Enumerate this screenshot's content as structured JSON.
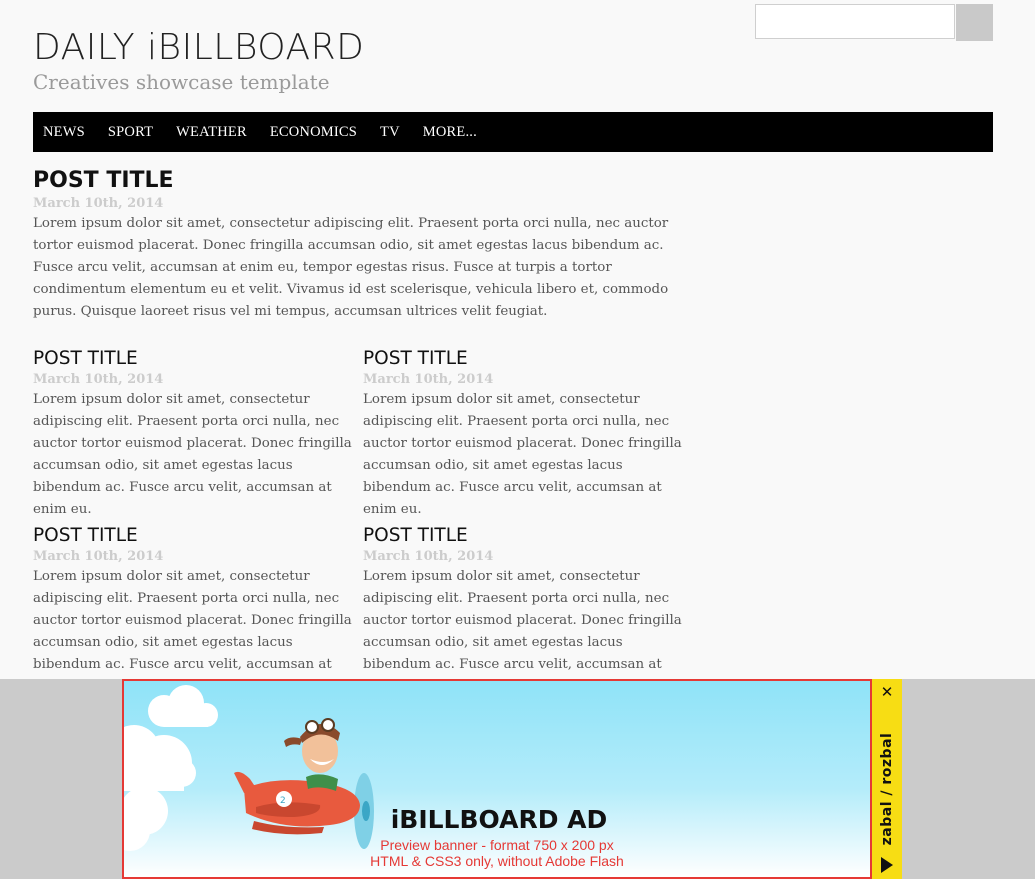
{
  "header": {
    "site_title": "DAILY iBILLBOARD",
    "site_subtitle": "Creatives showcase template"
  },
  "search": {
    "placeholder": "",
    "value": ""
  },
  "nav": {
    "items": [
      "NEWS",
      "SPORT",
      "WEATHER",
      "ECONOMICS",
      "TV",
      "MORE..."
    ]
  },
  "featured_post": {
    "title": "POST TITLE",
    "date": "March 10th, 2014",
    "body": "Lorem ipsum dolor sit amet, consectetur adipiscing elit. Praesent porta orci nulla, nec auctor tortor euismod placerat. Donec fringilla accumsan odio, sit amet egestas lacus bibendum ac. Fusce arcu velit, accumsan at enim eu, tempor egestas risus. Fusce at turpis a tortor condimentum elementum eu et velit. Vivamus id est scelerisque, vehicula libero et, commodo purus. Quisque laoreet risus vel mi tempus, accumsan ultrices velit feugiat."
  },
  "posts": [
    {
      "title": "POST TITLE",
      "date": "March 10th, 2014",
      "body": "Lorem ipsum dolor sit amet, consectetur adipiscing elit. Praesent porta orci nulla, nec auctor tortor euismod placerat. Donec fringilla accumsan odio, sit amet egestas lacus bibendum ac. Fusce arcu velit, accumsan at enim eu."
    },
    {
      "title": "POST TITLE",
      "date": "March 10th, 2014",
      "body": "Lorem ipsum dolor sit amet, consectetur adipiscing elit. Praesent porta orci nulla, nec auctor tortor euismod placerat. Donec fringilla accumsan odio, sit amet egestas lacus bibendum ac. Fusce arcu velit, accumsan at enim eu."
    },
    {
      "title": "POST TITLE",
      "date": "March 10th, 2014",
      "body": "Lorem ipsum dolor sit amet, consectetur adipiscing elit. Praesent porta orci nulla, nec auctor tortor euismod placerat. Donec fringilla accumsan odio, sit amet egestas lacus bibendum ac. Fusce arcu velit, accumsan at enim eu."
    },
    {
      "title": "POST TITLE",
      "date": "March 10th, 2014",
      "body": "Lorem ipsum dolor sit amet, consectetur adipiscing elit. Praesent porta orci nulla, nec auctor tortor euismod placerat. Donec fringilla accumsan odio, sit amet egestas lacus bibendum ac. Fusce arcu velit, accumsan at enim eu."
    }
  ],
  "ad": {
    "title": "iBILLBOARD AD",
    "line1": "Preview banner - format 750 x 200 px",
    "line2": "HTML & CSS3 only, without Adobe Flash",
    "toggle_label": "zabal / rozbal",
    "close_icon": "close-icon",
    "expand_icon": "triangle-right-icon",
    "illustration": "cartoon-pilot-airplane"
  },
  "colors": {
    "nav_background": "#000000",
    "ad_border": "#e53935",
    "ad_toggle": "#f7dd14",
    "ad_bar": "#cbcbcb",
    "ad_sky": "#8fe3f8",
    "date": "#cccccc",
    "subtitle": "#9a9a9a"
  }
}
